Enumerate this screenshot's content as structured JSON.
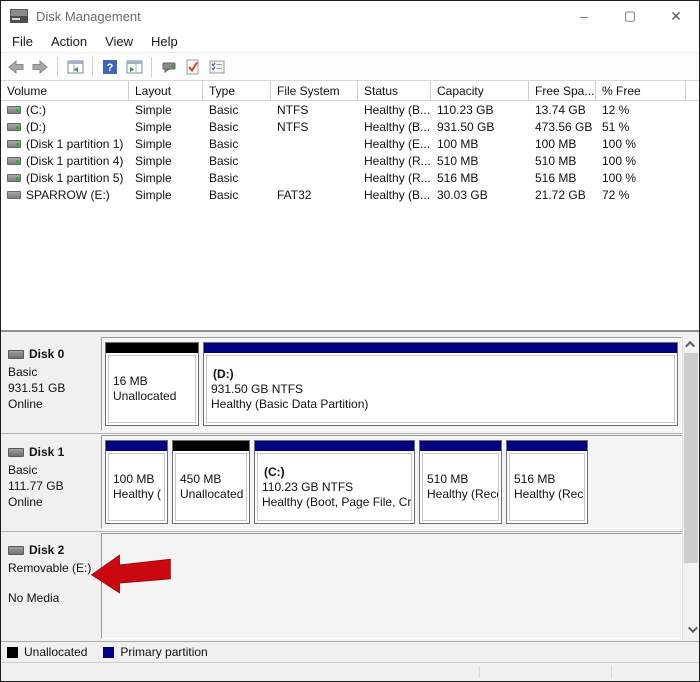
{
  "window": {
    "title": "Disk Management",
    "controls": {
      "minimize": "–",
      "maximize": "▢",
      "close": "✕"
    }
  },
  "menu": {
    "items": [
      "File",
      "Action",
      "View",
      "Help"
    ]
  },
  "toolbar": {
    "icons": [
      "back-icon",
      "forward-icon",
      "console-tree-icon",
      "help-icon",
      "show-hide-console-icon",
      "disk-popup-icon",
      "check-disk-icon",
      "task-list-icon"
    ]
  },
  "volume_table": {
    "columns": [
      "Volume",
      "Layout",
      "Type",
      "File System",
      "Status",
      "Capacity",
      "Free Spa...",
      "% Free"
    ],
    "rows": [
      [
        "(C:)",
        "Simple",
        "Basic",
        "NTFS",
        "Healthy (B...",
        "110.23 GB",
        "13.74 GB",
        "12 %"
      ],
      [
        "(D:)",
        "Simple",
        "Basic",
        "NTFS",
        "Healthy (B...",
        "931.50 GB",
        "473.56 GB",
        "51 %"
      ],
      [
        "(Disk 1 partition 1)",
        "Simple",
        "Basic",
        "",
        "Healthy (E...",
        "100 MB",
        "100 MB",
        "100 %"
      ],
      [
        "(Disk 1 partition 4)",
        "Simple",
        "Basic",
        "",
        "Healthy (R...",
        "510 MB",
        "510 MB",
        "100 %"
      ],
      [
        "(Disk 1 partition 5)",
        "Simple",
        "Basic",
        "",
        "Healthy (R...",
        "516 MB",
        "516 MB",
        "100 %"
      ],
      [
        "SPARROW (E:)",
        "Simple",
        "Basic",
        "FAT32",
        "Healthy (B...",
        "30.03 GB",
        "21.72 GB",
        "72 %"
      ]
    ]
  },
  "disks": [
    {
      "name": "Disk 0",
      "kind": "Basic",
      "size": "931.51 GB",
      "status": "Online",
      "partitions": [
        {
          "type": "unallocated",
          "color": "#000000",
          "title": "",
          "line1": "16 MB",
          "line2": "Unallocated"
        },
        {
          "type": "primary",
          "color": "#000080",
          "title": "(D:)",
          "line1": "931.50 GB NTFS",
          "line2": "Healthy (Basic Data Partition)"
        }
      ]
    },
    {
      "name": "Disk 1",
      "kind": "Basic",
      "size": "111.77 GB",
      "status": "Online",
      "partitions": [
        {
          "type": "primary",
          "color": "#000080",
          "title": "",
          "line1": "100 MB",
          "line2": "Healthy ("
        },
        {
          "type": "unallocated",
          "color": "#000000",
          "title": "",
          "line1": "450 MB",
          "line2": "Unallocated"
        },
        {
          "type": "primary",
          "color": "#000080",
          "title": "(C:)",
          "line1": "110.23 GB NTFS",
          "line2": "Healthy (Boot, Page File, Cra"
        },
        {
          "type": "primary",
          "color": "#000080",
          "title": "",
          "line1": "510 MB",
          "line2": "Healthy (Reco"
        },
        {
          "type": "primary",
          "color": "#000080",
          "title": "",
          "line1": "516 MB",
          "line2": "Healthy (Reco"
        }
      ]
    },
    {
      "name": "Disk 2",
      "kind": "Removable (E:)",
      "size": "",
      "status": "No Media",
      "partitions": []
    }
  ],
  "legend": {
    "items": [
      {
        "label": "Unallocated",
        "color": "#000000"
      },
      {
        "label": "Primary partition",
        "color": "#000080"
      }
    ]
  },
  "annotation": {
    "red_arrow_color": "#c9090f"
  },
  "colors": {
    "primary_partition": "#000080",
    "unallocated": "#000000",
    "panel_bg": "#f0f0f0"
  }
}
